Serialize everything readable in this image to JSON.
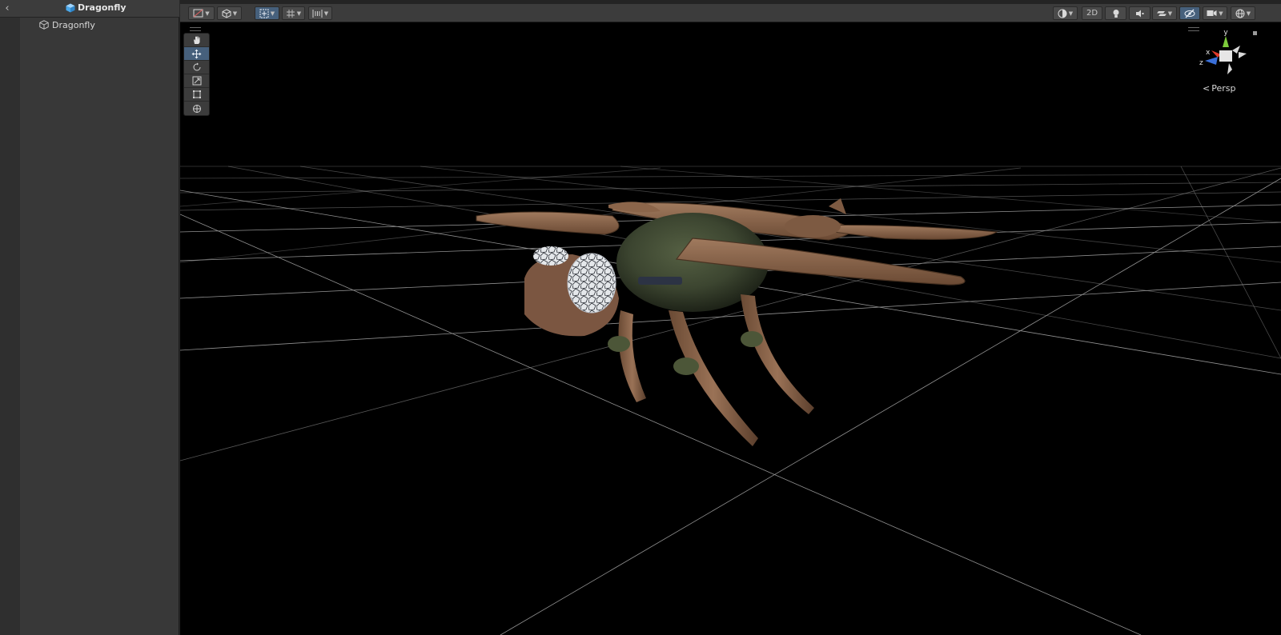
{
  "hierarchy": {
    "prefab_title": "Dragonfly",
    "items": [
      {
        "label": "Dragonfly",
        "icon": "gameobject-cube-icon"
      }
    ]
  },
  "scene_toolbar": {
    "left_groups": [
      "gizmo-draw-mode",
      "shading-mode",
      "move-snap",
      "grid-snap",
      "increment-snap"
    ],
    "right_buttons": [
      "draw-mode",
      "2D",
      "lighting",
      "audio",
      "effects",
      "scene-visibility",
      "camera",
      "gizmos"
    ],
    "mode_2d_label": "2D"
  },
  "tools": [
    "hand",
    "move",
    "rotate",
    "scale",
    "rect",
    "transform"
  ],
  "active_tool": "move",
  "view_gizmo": {
    "axis_y": "y",
    "axis_x": "x",
    "axis_z": "z",
    "projection_label": "Persp"
  },
  "colors": {
    "accent": "#46607c",
    "panel": "#383838",
    "viewport": "#000000",
    "axis_y": "#7dcc3b",
    "axis_x": "#e03a2a",
    "axis_z": "#3a6fd8"
  }
}
